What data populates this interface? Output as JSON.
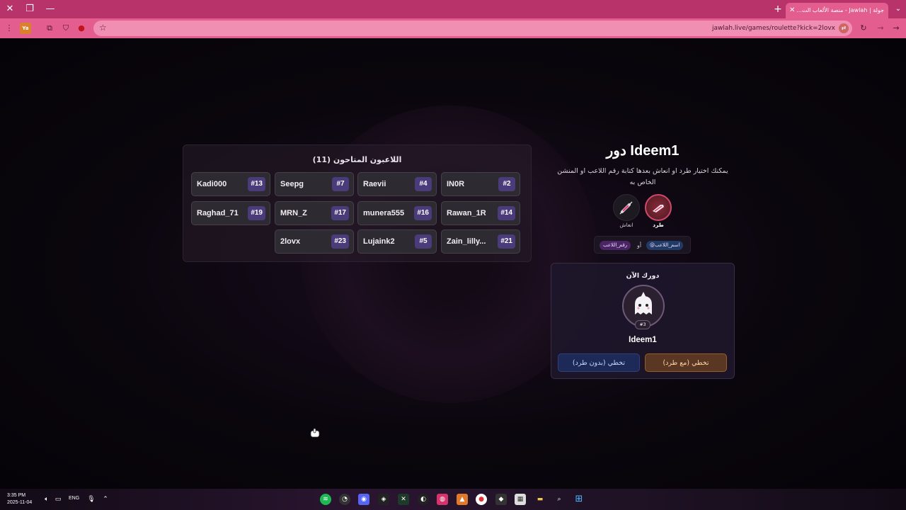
{
  "browser": {
    "tab_title": "جولة | Jawlah - منصة الألعاب الت...",
    "url": "jawlah.live/games/roulette?kick=2lovx"
  },
  "players_panel": {
    "title": "اللاعبون المتاحون (11)",
    "players": [
      {
        "name": "Kadi000",
        "number": "#13"
      },
      {
        "name": "Seepg",
        "number": "#7"
      },
      {
        "name": "Raevii",
        "number": "#4"
      },
      {
        "name": "IN0R",
        "number": "#2"
      },
      {
        "name": "Raghad_71",
        "number": "#19"
      },
      {
        "name": "MRN_Z",
        "number": "#17"
      },
      {
        "name": "munera555",
        "number": "#16"
      },
      {
        "name": "Rawan_1R",
        "number": "#14"
      },
      {
        "name": "2lovx",
        "number": "#23"
      },
      {
        "name": "Lujaink2",
        "number": "#5"
      },
      {
        "name": "Zain_lilly...",
        "number": "#21"
      }
    ]
  },
  "turn": {
    "title": "دور Ideem1",
    "description": "يمكنك اختيار طرد او انعاش بعدها كتابة رقم اللاعب او المنشن الخاص به",
    "actions": [
      {
        "label": "طرد",
        "icon": "kick-icon",
        "color": "#e0457a"
      },
      {
        "label": "انعاش",
        "icon": "syringe-icon",
        "color": "#e0457a"
      }
    ],
    "hint_by_name": "@اسم_اللاعب",
    "hint_or": "أو",
    "hint_by_number": "رقم_اللاعب"
  },
  "current": {
    "label": "دورك الآن",
    "avatar_number": "#3",
    "name": "Ideem1",
    "skip_with_kick": "تخطي (مع طرد)",
    "skip_without_kick": "تخطي (بدون طرد)"
  },
  "taskbar": {
    "time": "3:35 PM",
    "date": "2025-11-04",
    "lang": "ENG"
  }
}
